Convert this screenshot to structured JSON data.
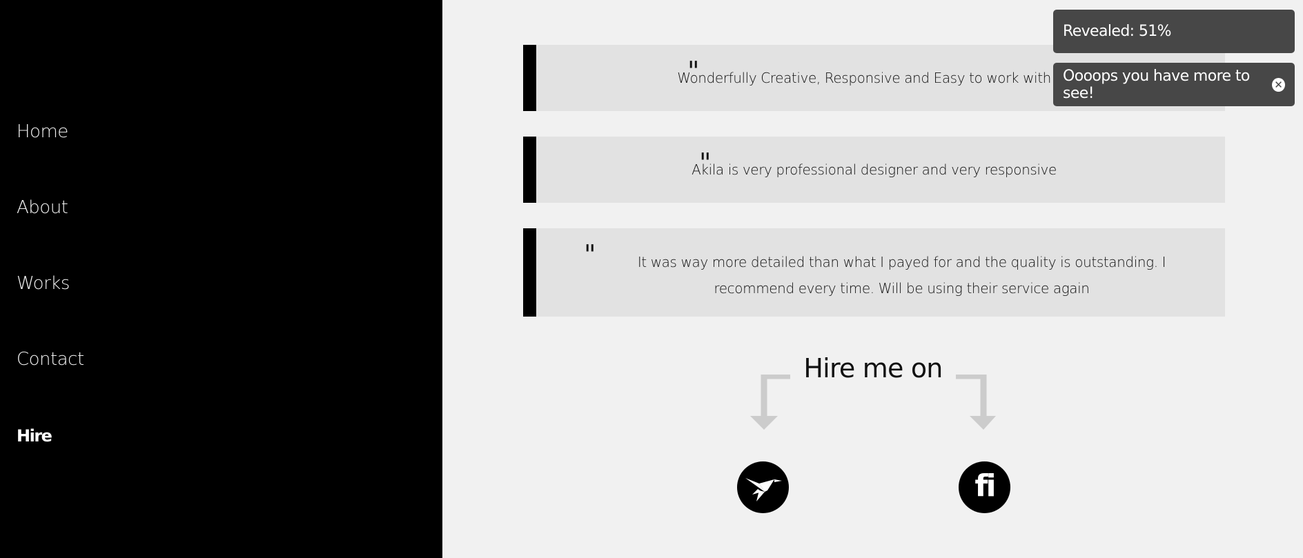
{
  "nav": {
    "items": [
      {
        "label": "Home"
      },
      {
        "label": "About"
      },
      {
        "label": "Works"
      },
      {
        "label": "Contact"
      },
      {
        "label": "Hire"
      }
    ]
  },
  "testimonials": [
    {
      "quote_mark": "\"",
      "text": "Wonderfully Creative, Responsive and Easy to work with !!!"
    },
    {
      "quote_mark": "\"",
      "text": "Akila is very professional designer and very responsive"
    },
    {
      "quote_mark": "\"",
      "text": "It was way more detailed than what I payed for and the quality is outstanding. I recommend every time. Will be using their service again"
    }
  ],
  "hire": {
    "title": "Hire me on",
    "freelancer_icon": "hummingbird-icon",
    "fiverr_label": "fi"
  },
  "toasts": {
    "revealed": "Revealed: 51%",
    "more": "Oooops you have more to see!",
    "close_icon": "close-circle-icon"
  },
  "colors": {
    "sidebar": "#000000",
    "content_bg": "#f1f1f1",
    "card_bg": "#e2e2e2",
    "toast_bg": "#474747",
    "arrow": "#cccccc"
  }
}
